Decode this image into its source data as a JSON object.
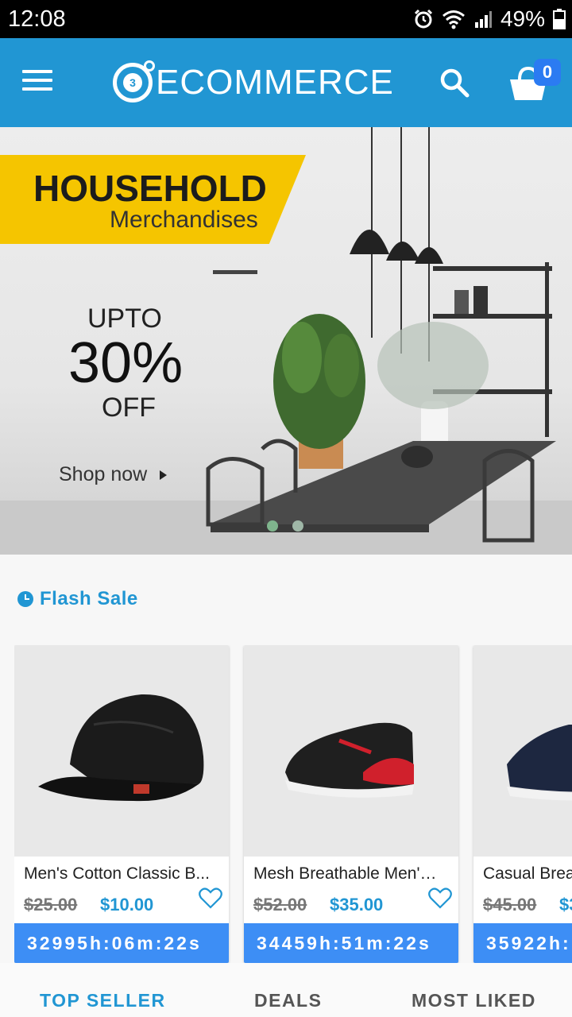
{
  "status": {
    "time": "12:08",
    "battery": "49%"
  },
  "appbar": {
    "brand": "ECOMMERCE",
    "logo_number": "3",
    "cart_count": "0"
  },
  "banner": {
    "title": "HOUSEHOLD",
    "subtitle": "Merchandises",
    "upto": "UPTO",
    "percent": "30%",
    "off": "OFF",
    "cta": "Shop now",
    "slide_index": 0,
    "slide_count": 2
  },
  "flash": {
    "heading": "Flash Sale",
    "products": [
      {
        "name": "Men's Cotton Classic B...",
        "old_price": "$25.00",
        "new_price": "$10.00",
        "timer": "32995h:06m:22s"
      },
      {
        "name": "Mesh Breathable Men's ...",
        "old_price": "$52.00",
        "new_price": "$35.00",
        "timer": "34459h:51m:22s"
      },
      {
        "name": "Casual Brea",
        "old_price": "$45.00",
        "new_price": "$3",
        "timer": "35922h:"
      }
    ]
  },
  "tabs": [
    "TOP SELLER",
    "DEALS",
    "MOST LIKED"
  ],
  "colors": {
    "primary": "#2196d3",
    "accent": "#3d8ef5",
    "banner_tag": "#f5c500"
  }
}
